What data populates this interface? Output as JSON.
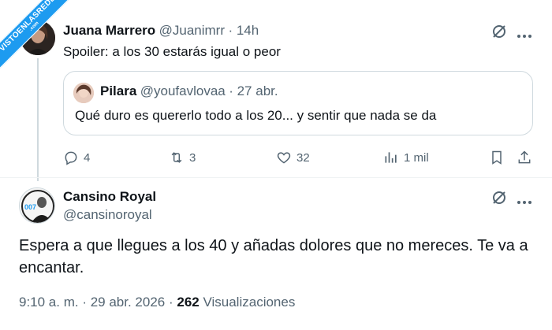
{
  "watermark": {
    "text": "VISTOENLASREDES",
    "sub": ".com"
  },
  "reply_tweet": {
    "author_name": "Juana Marrero",
    "author_handle": "@Juanimrr",
    "time": "· 14h",
    "text": "Spoiler: a los 30 estarás igual o peor",
    "quote": {
      "author_name": "Pilara",
      "author_handle": "@youfavlovaa",
      "time": "· 27 abr.",
      "text": "Qué duro es quererlo todo a los 20... y sentir que nada se da"
    },
    "actions": {
      "replies": "4",
      "reposts": "3",
      "likes": "32",
      "views": "1 mil"
    }
  },
  "main_tweet": {
    "author_name": "Cansino Royal",
    "author_handle": "@cansinoroyal",
    "text": "Espera a que llegues a los 40 y añadas dolores que no mereces. Te va a encantar.",
    "time": "9:10 a. m. · 29 abr. 2026 ·",
    "views_count": "262",
    "views_label": "Visualizaciones"
  },
  "colors": {
    "accent": "#1d9bf0",
    "secondary_text": "#536471",
    "border": "#cfd9de"
  }
}
